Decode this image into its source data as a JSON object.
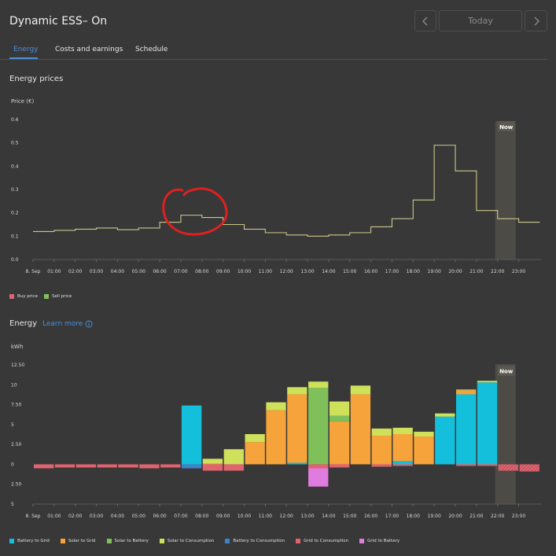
{
  "header": {
    "title": "Dynamic ESS– On",
    "prev_icon": "chevron-left-icon",
    "next_icon": "chevron-right-icon",
    "date_label": "Today"
  },
  "tabs": [
    {
      "label": "Energy",
      "active": true
    },
    {
      "label": "Costs and earnings",
      "active": false
    },
    {
      "label": "Schedule",
      "active": false
    }
  ],
  "colors": {
    "background": "#383838",
    "accent": "#4a90d9",
    "price_line": "#c9c88a",
    "now_band": "#4d4b45",
    "battery_to_grid": "#14bfdb",
    "solar_to_grid": "#f5a33a",
    "solar_to_battery": "#7fc05a",
    "solar_to_consumption": "#cfe05a",
    "battery_to_consumption": "#3b84c7",
    "grid_to_consumption": "#e06470",
    "grid_to_battery": "#e07ce0"
  },
  "prices_section": {
    "title": "Energy prices",
    "unit_label": "Price (€)",
    "now_label": "Now",
    "legend": [
      {
        "label": "Buy price",
        "color": "#e06470"
      },
      {
        "label": "Sell price",
        "color": "#7fc05a"
      }
    ]
  },
  "energy_section": {
    "title": "Energy",
    "learn_more": "Learn more",
    "info_icon": "info-icon",
    "unit_label": "kWh",
    "now_label": "Now",
    "legend": [
      {
        "label": "Battery to Grid",
        "color": "#14bfdb"
      },
      {
        "label": "Solar to Grid",
        "color": "#f5a33a"
      },
      {
        "label": "Solar to Battery",
        "color": "#7fc05a"
      },
      {
        "label": "Solar to Consumption",
        "color": "#cfe05a"
      },
      {
        "label": "Battery to Consumption",
        "color": "#3b84c7"
      },
      {
        "label": "Grid to Consumption",
        "color": "#e06470"
      },
      {
        "label": "Grid to Battery",
        "color": "#e07ce0"
      }
    ]
  },
  "annotation": {
    "type": "red-circle",
    "description": "hand-drawn red circle around 07:00–09:00 price step"
  },
  "chart_data": [
    {
      "type": "line",
      "title": "Energy prices",
      "ylabel": "Price (€)",
      "ylim": [
        0,
        0.6
      ],
      "yticks": [
        "0.0",
        "0.1",
        "0.2",
        "0.3",
        "0.4",
        "0.5",
        "0.6"
      ],
      "categories": [
        "8. Sep",
        "01:00",
        "02:00",
        "03:00",
        "04:00",
        "05:00",
        "06:00",
        "07:00",
        "08:00",
        "09:00",
        "10:00",
        "11:00",
        "12:00",
        "13:00",
        "14:00",
        "15:00",
        "16:00",
        "17:00",
        "18:00",
        "19:00",
        "20:00",
        "21:00",
        "22:00",
        "23:00"
      ],
      "series": [
        {
          "values": [
            0.12,
            0.125,
            0.13,
            0.135,
            0.128,
            0.135,
            0.16,
            0.19,
            0.18,
            0.15,
            0.13,
            0.115,
            0.105,
            0.1,
            0.105,
            0.115,
            0.14,
            0.175,
            0.255,
            0.49,
            0.38,
            0.21,
            0.175,
            0.16
          ]
        }
      ],
      "now_label": "Now",
      "now_index": 22,
      "grid": false
    },
    {
      "type": "bar",
      "title": "Energy",
      "ylabel": "kWh",
      "ylim": [
        -5,
        12.5
      ],
      "yticks": [
        "5",
        "2.50",
        "0",
        "2.50",
        "5",
        "7.50",
        "10",
        "12.50"
      ],
      "categories": [
        "8. Sep",
        "01:00",
        "02:00",
        "03:00",
        "04:00",
        "05:00",
        "06:00",
        "07:00",
        "08:00",
        "09:00",
        "10:00",
        "11:00",
        "12:00",
        "13:00",
        "14:00",
        "15:00",
        "16:00",
        "17:00",
        "18:00",
        "19:00",
        "20:00",
        "21:00",
        "22:00",
        "23:00"
      ],
      "stacked": true,
      "series": [
        {
          "name": "Battery to Grid",
          "values": [
            0,
            0,
            0,
            0,
            0,
            0,
            0,
            7.4,
            0,
            0,
            0,
            0,
            0.2,
            0,
            0,
            0,
            0,
            0.4,
            0,
            6.0,
            8.8,
            10.3,
            0,
            0
          ]
        },
        {
          "name": "Solar to Grid",
          "values": [
            0,
            0,
            0,
            0,
            0,
            0,
            0,
            0,
            0.1,
            0,
            2.8,
            6.8,
            8.6,
            0,
            5.4,
            8.8,
            3.6,
            3.4,
            3.5,
            0,
            0.5,
            0,
            0,
            0
          ]
        },
        {
          "name": "Solar to Battery",
          "values": [
            0,
            0,
            0,
            0,
            0,
            0,
            0,
            0,
            0,
            0,
            0,
            0,
            0,
            9.6,
            0.7,
            0,
            0,
            0,
            0,
            0,
            0,
            0,
            0,
            0
          ]
        },
        {
          "name": "Solar to Consumption",
          "values": [
            0,
            0,
            0,
            0,
            0,
            0,
            0,
            0,
            0.6,
            1.9,
            1.0,
            1.0,
            0.9,
            0.8,
            1.8,
            1.1,
            0.9,
            0.8,
            0.6,
            0.4,
            0.1,
            0.2,
            0,
            0
          ]
        },
        {
          "name": "Battery to Consumption",
          "values": [
            0,
            0,
            0,
            0,
            0,
            0,
            0,
            -0.5,
            0,
            0,
            0,
            0,
            0,
            0,
            0,
            0,
            0,
            0,
            0,
            0,
            0,
            0,
            0,
            0
          ]
        },
        {
          "name": "Grid to Consumption",
          "values": [
            -0.5,
            -0.4,
            -0.4,
            -0.4,
            -0.4,
            -0.5,
            -0.4,
            0,
            -0.8,
            -0.8,
            0,
            0,
            0,
            -0.5,
            -0.4,
            0,
            -0.3,
            -0.2,
            0,
            0,
            -0.2,
            -0.2,
            -0.8,
            -0.9
          ]
        },
        {
          "name": "Grid to Battery",
          "values": [
            0,
            0,
            0,
            0,
            0,
            0,
            0,
            0,
            0,
            0,
            0,
            0,
            0,
            -2.3,
            0,
            0,
            0,
            0,
            0,
            0,
            0,
            0,
            0,
            0
          ]
        }
      ],
      "now_label": "Now",
      "now_index": 22,
      "grid": false
    }
  ]
}
